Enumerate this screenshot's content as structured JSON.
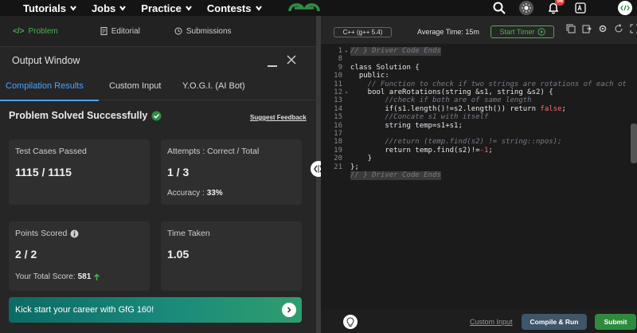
{
  "nav": {
    "items": [
      {
        "label": "Tutorials"
      },
      {
        "label": "Jobs"
      },
      {
        "label": "Practice"
      },
      {
        "label": "Contests"
      }
    ],
    "notification_count": "56",
    "logo_icon": "gfg-logo-icon",
    "accent_color": "#2f8d46"
  },
  "left_tabs": {
    "problem": "Problem",
    "editorial": "Editorial",
    "submissions": "Submissions"
  },
  "output": {
    "title": "Output Window",
    "tabs": {
      "compilation": "Compilation Results",
      "custom_input": "Custom Input",
      "yogi": "Y.O.G.I. (AI Bot)"
    },
    "status": "Problem Solved Successfully",
    "suggest_feedback": "Suggest Feedback",
    "cards": {
      "test_cases_label": "Test Cases Passed",
      "test_cases_value": "1115 / 1115",
      "attempts_label": "Attempts : Correct / Total",
      "attempts_value": "1 / 3",
      "accuracy_label": "Accuracy :",
      "accuracy_value": "33%",
      "points_label": "Points Scored",
      "points_value": "2 / 2",
      "total_score_label": "Your Total Score:",
      "total_score_value": "581",
      "time_label": "Time Taken",
      "time_value": "1.05"
    },
    "banner": "Kick start your career with GfG 160!"
  },
  "editor": {
    "language": "C++ (g++ 5.4)",
    "avg_time": "Average Time: 15m",
    "start_timer": "Start Timer",
    "custom_input": "Custom Input",
    "compile_run": "Compile & Run",
    "submit": "Submit",
    "lines": [
      {
        "n": "1",
        "text": "// } Driver Code Ends",
        "kind": "cm",
        "hl": true,
        "fold": "▸"
      },
      {
        "n": "8",
        "text": "",
        "kind": ""
      },
      {
        "n": "9",
        "text": "class Solution {",
        "kind": ""
      },
      {
        "n": "10",
        "text": "  public:",
        "kind": ""
      },
      {
        "n": "11",
        "text": "    // Function to check if two strings are rotations of each ot",
        "kind": "cm"
      },
      {
        "n": "12",
        "text": "    bool areRotations(string &s1, string &s2) {",
        "kind": "",
        "fold": "▾"
      },
      {
        "n": "13",
        "text": "        //check if both are of same length",
        "kind": "cm"
      },
      {
        "n": "14",
        "text": "        if(s1.length()!=s2.length()) return false;",
        "kind": "mix"
      },
      {
        "n": "15",
        "text": "        //Concate s1 with itself",
        "kind": "cm"
      },
      {
        "n": "16",
        "text": "        string temp=s1+s1;",
        "kind": ""
      },
      {
        "n": "17",
        "text": "",
        "kind": ""
      },
      {
        "n": "18",
        "text": "        //return (temp.find(s2) != string::npos);",
        "kind": "cm"
      },
      {
        "n": "19",
        "text": "        return temp.find(s2)!=-1;",
        "kind": "mix2"
      },
      {
        "n": "20",
        "text": "    }",
        "kind": ""
      },
      {
        "n": "21",
        "text": "};",
        "kind": ""
      },
      {
        "n": "",
        "text": "// } Driver Code Ends",
        "kind": "cm",
        "hl": true
      }
    ]
  }
}
